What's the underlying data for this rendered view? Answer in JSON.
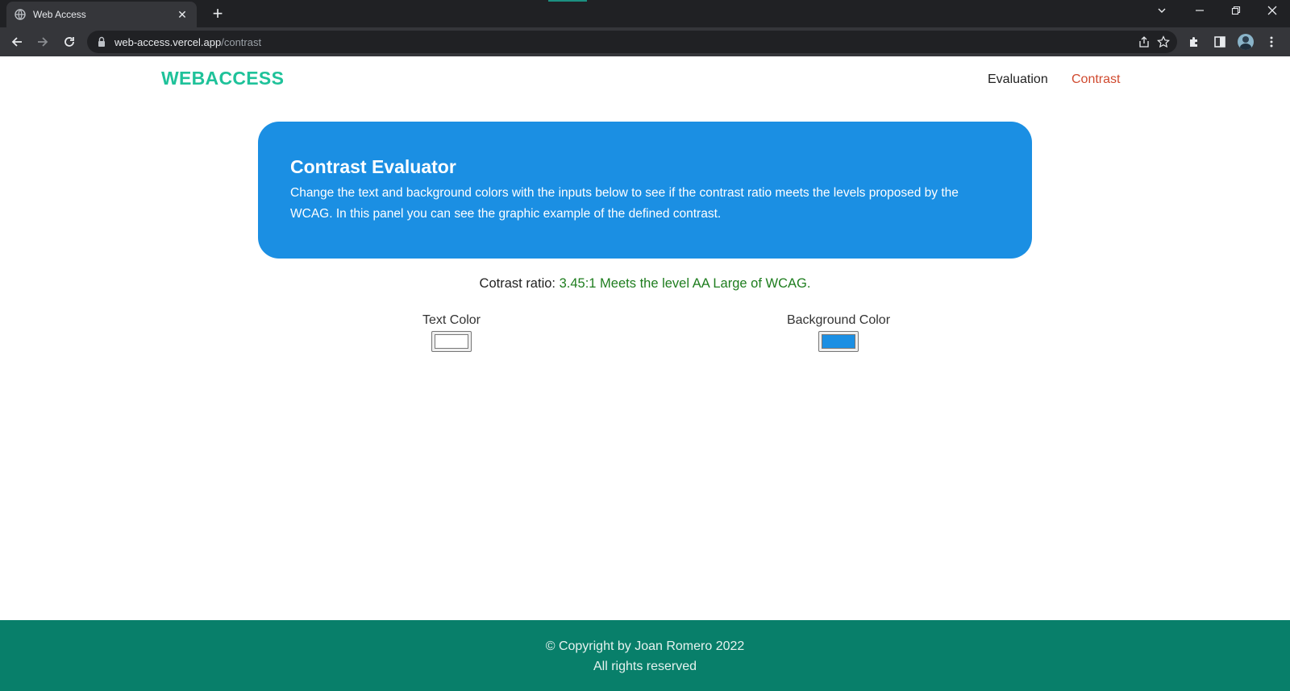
{
  "browser": {
    "tab_title": "Web Access",
    "url_host": "web-access.vercel.app",
    "url_path": "/contrast"
  },
  "site": {
    "logo": "WEBACCESS",
    "nav": [
      {
        "label": "Evaluation",
        "active": false
      },
      {
        "label": "Contrast",
        "active": true
      }
    ]
  },
  "panel": {
    "title": "Contrast Evaluator",
    "description": "Change the text and background colors with the inputs below to see if the contrast ratio meets the levels proposed by the WCAG. In this panel you can see the graphic example of the defined contrast."
  },
  "ratio": {
    "label": "Cotrast ratio:",
    "value": "3.45:1 Meets the level AA Large of WCAG."
  },
  "pickers": {
    "text_label": "Text Color",
    "text_value": "#ffffff",
    "background_label": "Background Color",
    "background_value": "#1b8fe3"
  },
  "footer": {
    "copyright": "© Copyright by Joan Romero 2022",
    "rights": "All rights reserved"
  },
  "colors": {
    "brand": "#1fc29a",
    "nav_active": "#d04a2f",
    "panel_bg": "#1b8fe3",
    "ratio_ok": "#1e7d1e",
    "footer_bg": "#087f6a"
  }
}
